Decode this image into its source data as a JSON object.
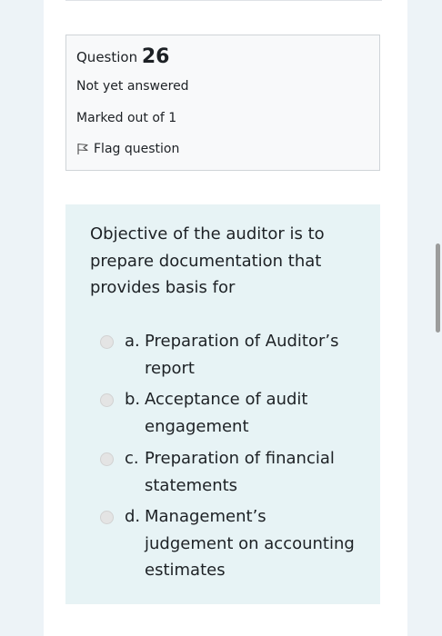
{
  "info": {
    "question_word": "Question",
    "question_number": "26",
    "state": "Not yet answered",
    "grade": "Marked out of 1",
    "flag_label": "Flag question"
  },
  "question": {
    "text": "Objective of the auditor is to prepare documentation that provides basis for",
    "answers": [
      {
        "letter": "a.",
        "text": "Preparation of Auditor’s report"
      },
      {
        "letter": "b.",
        "text": "Acceptance of audit engagement"
      },
      {
        "letter": "c.",
        "text": "Preparation of financial statements"
      },
      {
        "letter": "d.",
        "text": "Management’s judgement on accounting estimates"
      }
    ]
  }
}
